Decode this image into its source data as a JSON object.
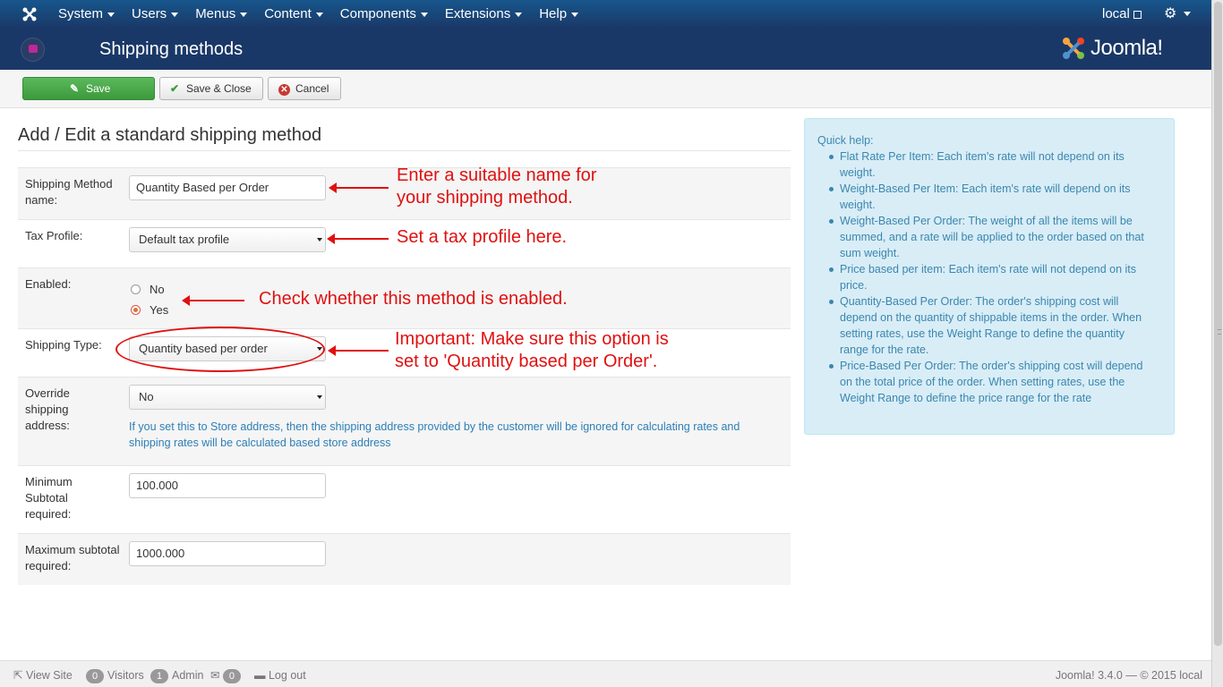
{
  "topnav": {
    "menu": [
      {
        "label": "System"
      },
      {
        "label": "Users"
      },
      {
        "label": "Menus"
      },
      {
        "label": "Content"
      },
      {
        "label": "Components"
      },
      {
        "label": "Extensions"
      },
      {
        "label": "Help"
      }
    ],
    "site_link": "local"
  },
  "header": {
    "title": "Shipping methods",
    "brand": "Joomla!"
  },
  "toolbar": {
    "save": "Save",
    "save_close": "Save & Close",
    "cancel": "Cancel"
  },
  "form": {
    "heading": "Add / Edit a standard shipping method",
    "name_label": "Shipping Method name:",
    "name_value": "Quantity Based per Order",
    "tax_label": "Tax Profile:",
    "tax_value": "Default tax profile",
    "enabled_label": "Enabled:",
    "enabled_no": "No",
    "enabled_yes": "Yes",
    "enabled_selected": "Yes",
    "type_label": "Shipping Type:",
    "type_value": "Quantity based per order",
    "override_label": "Override shipping address:",
    "override_value": "No",
    "override_help": "If you set this to Store address, then the shipping address provided by the customer will be ignored for calculating rates and shipping rates will be calculated based store address",
    "min_label": "Minimum Subtotal required:",
    "min_value": "100.000",
    "max_label": "Maximum subtotal required:",
    "max_value": "1000.000"
  },
  "annotations": {
    "name_line1": "Enter a suitable name for",
    "name_line2": "your shipping method.",
    "tax": "Set a tax profile here.",
    "enabled": "Check whether this method is enabled.",
    "type_line1": "Important: Make sure this option is",
    "type_line2": "set to 'Quantity based per Order'."
  },
  "quickhelp": {
    "title": "Quick help:",
    "items": [
      "Flat Rate Per Item: Each item's rate will not depend on its weight.",
      "Weight-Based Per Item: Each item's rate will depend on its weight.",
      "Weight-Based Per Order: The weight of all the items will be summed, and a rate will be applied to the order based on that sum weight.",
      "Price based per item: Each item's rate will not depend on its price.",
      "Quantity-Based Per Order: The order's shipping cost will depend on the quantity of shippable items in the order. When setting rates, use the Weight Range to define the quantity range for the rate.",
      "Price-Based Per Order: The order's shipping cost will depend on the total price of the order. When setting rates, use the Weight Range to define the price range for the rate"
    ]
  },
  "footer": {
    "view_site": "View Site",
    "visitors_count": "0",
    "visitors_label": "Visitors",
    "admin_count": "1",
    "admin_label": "Admin",
    "messages_count": "0",
    "logout": "Log out",
    "version": "Joomla! 3.4.0 — © 2015 local"
  },
  "colors": {
    "navbar": "#1a3867",
    "save_button": "#4cae4c",
    "annotation": "#e01010",
    "quickhelp_bg": "#d9edf7",
    "quickhelp_text": "#3a87ad"
  }
}
